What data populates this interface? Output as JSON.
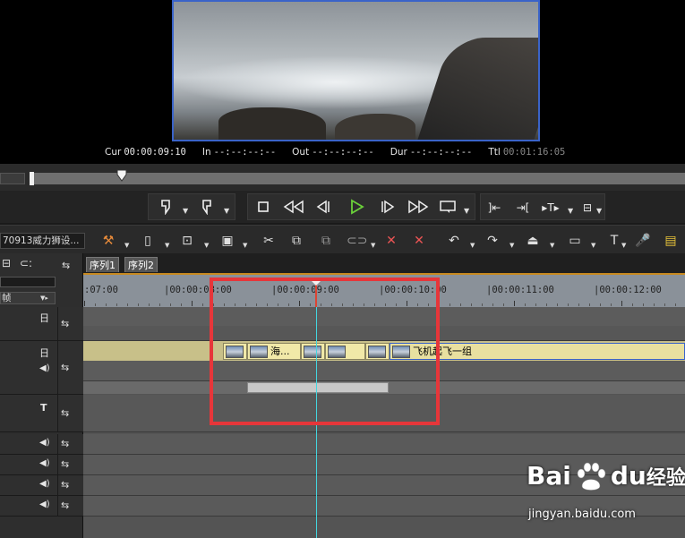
{
  "timecode": {
    "cur_label": "Cur",
    "cur_value": "00:00:09:10",
    "in_label": "In",
    "in_value": "--:--:--:--",
    "out_label": "Out",
    "out_value": "--:--:--:--",
    "dur_label": "Dur",
    "dur_value": "--:--:--:--",
    "ttl_label": "Ttl",
    "ttl_value": "00:01:16:05"
  },
  "project": {
    "name": "70913威力狮设..."
  },
  "tabs": [
    {
      "label": "序列1"
    },
    {
      "label": "序列2"
    }
  ],
  "track_header": {
    "zoom_label": "帧"
  },
  "ruler": {
    "labels": [
      ":07:00",
      "|00:00:08:00",
      "|00:00:09:00",
      "|00:00:10:00",
      "|00:00:11:00",
      "|00:00:12:00"
    ]
  },
  "clips": [
    {
      "label": ""
    },
    {
      "label": "海..."
    },
    {
      "label": ""
    },
    {
      "label": ""
    },
    {
      "label": ""
    },
    {
      "label": "飞机起飞一组"
    }
  ],
  "watermark": {
    "brand": "Bai",
    "brand_suffix": "du",
    "cn": "经验",
    "url": "jingyan.baidu.com"
  },
  "colors": {
    "accent_blue": "#3a63c8",
    "playhead_cyan": "#43d6e0",
    "highlight_red": "#e6363a",
    "clip_yellow": "#f1e9a8"
  },
  "icons": {
    "transport": [
      "set-in-icon",
      "set-out-icon",
      "stop-icon",
      "rewind-icon",
      "step-back-icon",
      "play-icon",
      "step-forward-icon",
      "fast-forward-icon",
      "loop-icon",
      "goto-in-icon",
      "goto-out-icon",
      "insert-icon",
      "overwrite-icon"
    ],
    "toolbar": [
      "tool-icon",
      "new-icon",
      "open-icon",
      "save-icon",
      "cut-icon",
      "copy-icon",
      "paste-icon",
      "link-icon",
      "delete-icon",
      "ripple-delete-icon",
      "undo-icon",
      "redo-icon",
      "marker-icon",
      "mixer-icon",
      "title-icon",
      "mic-icon",
      "render-icon"
    ]
  }
}
